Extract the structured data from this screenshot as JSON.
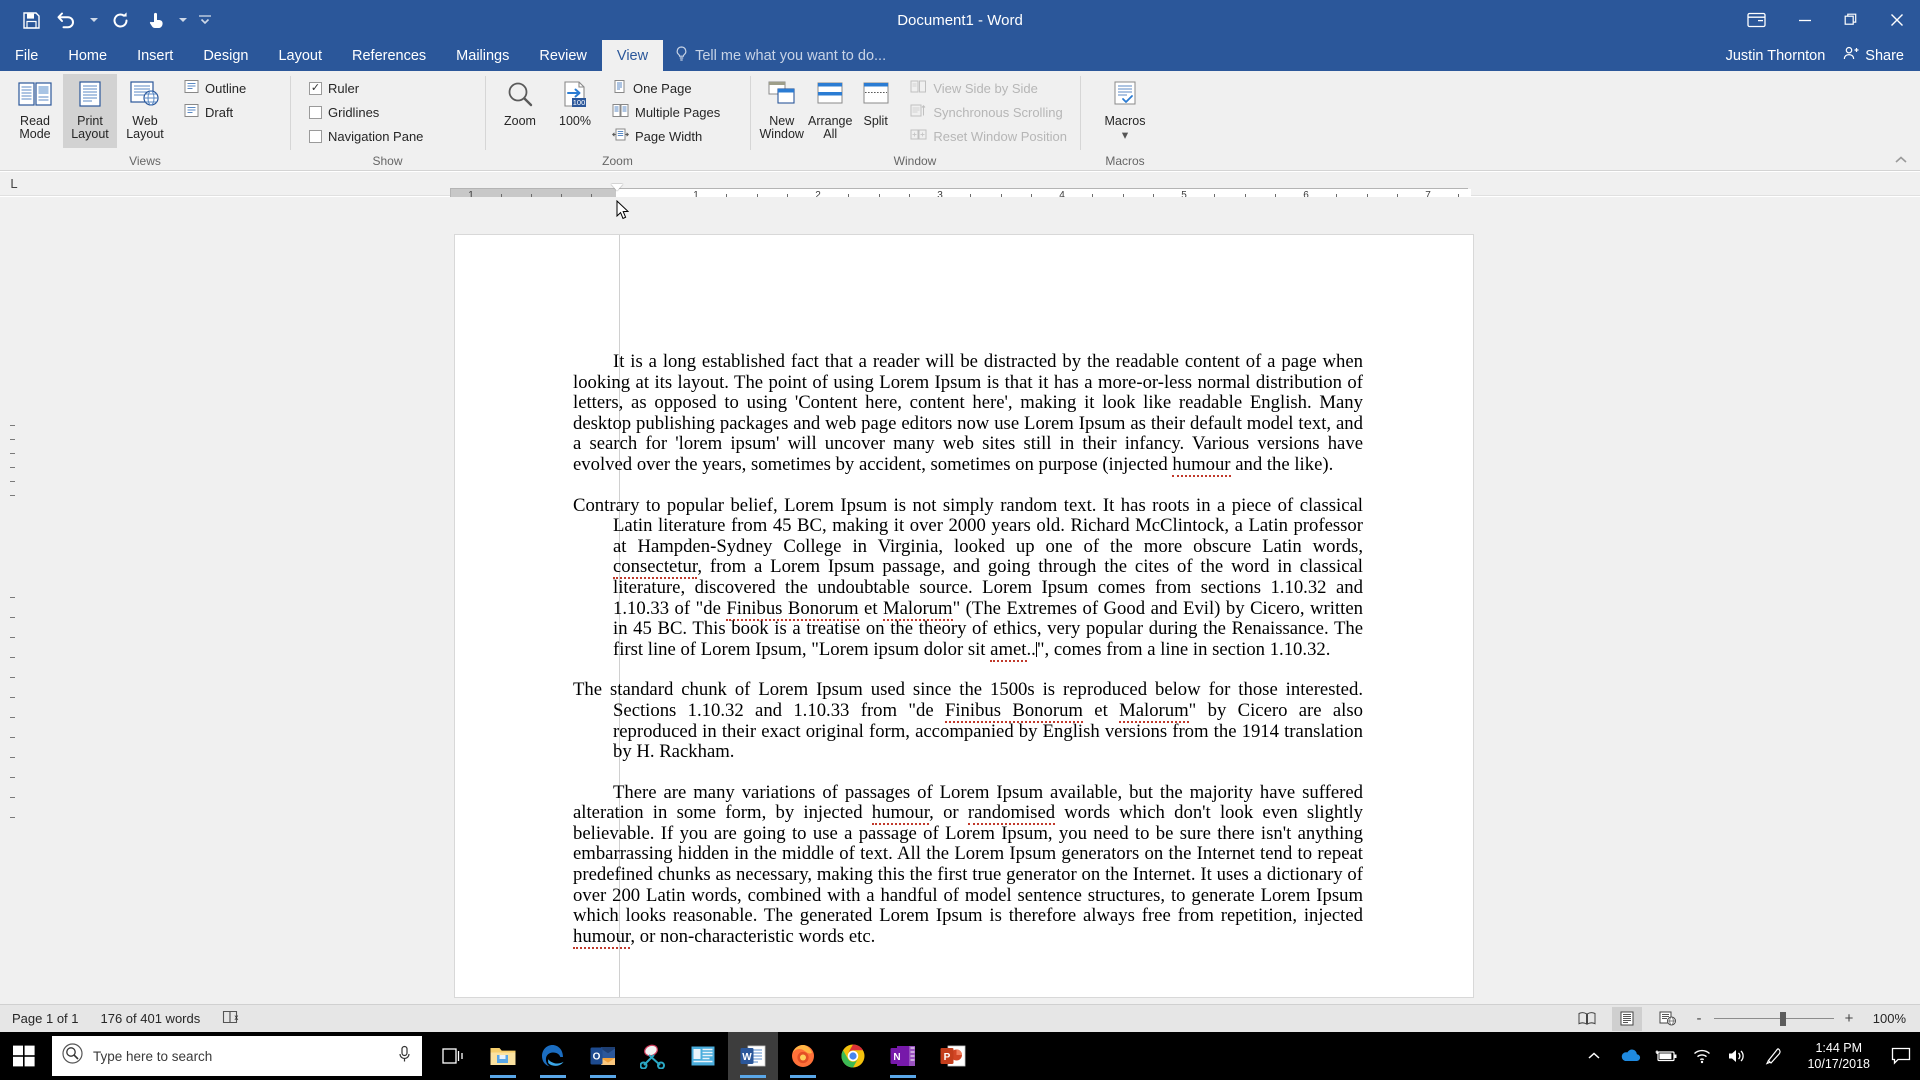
{
  "window": {
    "title": "Document1 - Word",
    "quick_access": [
      {
        "name": "save-icon",
        "label": "Save"
      },
      {
        "name": "undo-icon",
        "label": "Undo"
      },
      {
        "name": "redo-icon",
        "label": "Repeat Typing"
      },
      {
        "name": "touch-mode-icon",
        "label": "Touch/Mouse Mode"
      },
      {
        "name": "customize-qat-icon",
        "label": "Customize Quick Access Toolbar"
      }
    ],
    "controls": [
      {
        "name": "ribbon-display-options",
        "label": "Ribbon Display Options"
      },
      {
        "name": "minimize",
        "label": "Minimize"
      },
      {
        "name": "restore",
        "label": "Restore Down"
      },
      {
        "name": "close",
        "label": "Close"
      }
    ]
  },
  "tabs": [
    {
      "label": "File",
      "active": false
    },
    {
      "label": "Home",
      "active": false
    },
    {
      "label": "Insert",
      "active": false
    },
    {
      "label": "Design",
      "active": false
    },
    {
      "label": "Layout",
      "active": false
    },
    {
      "label": "References",
      "active": false
    },
    {
      "label": "Mailings",
      "active": false
    },
    {
      "label": "Review",
      "active": false
    },
    {
      "label": "View",
      "active": true
    }
  ],
  "tell_me": {
    "placeholder": "Tell me what you want to do...",
    "icon": "lightbulb-icon"
  },
  "account": {
    "user": "Justin Thornton",
    "share_label": "Share",
    "share_icon": "person-share-icon"
  },
  "ribbon": {
    "collapse_label": "⌃",
    "groups": [
      {
        "label": "Views",
        "big_buttons": [
          {
            "label": "Read\nMode",
            "line1": "Read",
            "line2": "Mode",
            "icon": "read-mode-icon",
            "active": false
          },
          {
            "label": "Print Layout",
            "line1": "Print",
            "line2": "Layout",
            "icon": "print-layout-icon",
            "active": true
          },
          {
            "label": "Web Layout",
            "line1": "Web",
            "line2": "Layout",
            "icon": "web-layout-icon",
            "active": false
          }
        ],
        "small_buttons": [
          {
            "label": "Outline",
            "icon": "outline-icon",
            "disabled": false
          },
          {
            "label": "Draft",
            "icon": "draft-icon",
            "disabled": false
          }
        ]
      },
      {
        "label": "Show",
        "checkboxes": [
          {
            "label": "Ruler",
            "checked": true
          },
          {
            "label": "Gridlines",
            "checked": false
          },
          {
            "label": "Navigation Pane",
            "checked": false
          }
        ]
      },
      {
        "label": "Zoom",
        "big_buttons": [
          {
            "label": "Zoom",
            "line1": "Zoom",
            "line2": "",
            "icon": "zoom-magnifier-icon",
            "active": false
          },
          {
            "label": "100%",
            "line1": "100%",
            "line2": "",
            "icon": "zoom-100-icon",
            "active": false
          }
        ],
        "small_buttons": [
          {
            "label": "One Page",
            "icon": "one-page-icon",
            "disabled": false
          },
          {
            "label": "Multiple Pages",
            "icon": "multiple-pages-icon",
            "disabled": false
          },
          {
            "label": "Page Width",
            "icon": "page-width-icon",
            "disabled": false
          }
        ]
      },
      {
        "label": "Window",
        "big_buttons": [
          {
            "label": "New Window",
            "line1": "New",
            "line2": "Window",
            "icon": "new-window-icon",
            "active": false
          },
          {
            "label": "Arrange All",
            "line1": "Arrange",
            "line2": "All",
            "icon": "arrange-all-icon",
            "active": false
          },
          {
            "label": "Split",
            "line1": "Split",
            "line2": "",
            "icon": "split-icon",
            "active": false
          }
        ],
        "small_buttons": [
          {
            "label": "View Side by Side",
            "icon": "view-side-by-side-icon",
            "disabled": true
          },
          {
            "label": "Synchronous Scrolling",
            "icon": "synchronous-scrolling-icon",
            "disabled": true
          },
          {
            "label": "Reset Window Position",
            "icon": "reset-window-position-icon",
            "disabled": true
          }
        ]
      },
      {
        "label": "Macros",
        "big_buttons": [
          {
            "label": "Macros",
            "line1": "Macros",
            "line2": "",
            "icon": "macros-icon",
            "active": false,
            "dropdown": true
          }
        ]
      }
    ]
  },
  "ruler": {
    "tab_selector": "L",
    "numbers": [
      "1",
      "1",
      "2",
      "3",
      "4",
      "5",
      "6",
      "7"
    ],
    "unit": "inches"
  },
  "document": {
    "paragraphs": [
      {
        "style": "first-line-indent",
        "text": "It is a long established fact that a reader will be distracted by the readable content of a page when looking at its layout. The point of using Lorem Ipsum is that it has a more-or-less normal distribution of letters, as opposed to using 'Content here, content here', making it look like readable English. Many desktop publishing packages and web page editors now use Lorem Ipsum as their default model text, and a search for 'lorem ipsum' will uncover many web sites still in their infancy. Various versions have evolved over the years, sometimes by accident, sometimes on purpose (injected humour and the like)."
      },
      {
        "style": "hanging-indent",
        "text": "Contrary to popular belief, Lorem Ipsum is not simply random text. It has roots in a piece of classical Latin literature from 45 BC, making it over 2000 years old. Richard McClintock, a Latin professor at Hampden-Sydney College in Virginia, looked up one of the more obscure Latin words, consectetur, from a Lorem Ipsum passage, and going through the cites of the word in classical literature, discovered the undoubtable source. Lorem Ipsum comes from sections 1.10.32 and 1.10.33 of \"de Finibus Bonorum et Malorum\" (The Extremes of Good and Evil) by Cicero, written in 45 BC. This book is a treatise on the theory of ethics, very popular during the Renaissance. The first line of Lorem Ipsum, \"Lorem ipsum dolor sit amet..\", comes from a line in section 1.10.32."
      },
      {
        "style": "hanging-indent",
        "text": "The standard chunk of Lorem Ipsum used since the 1500s is reproduced below for those interested. Sections 1.10.32 and 1.10.33 from \"de Finibus Bonorum et Malorum\" by Cicero are also reproduced in their exact original form, accompanied by English versions from the 1914 translation by H. Rackham."
      },
      {
        "style": "first-line-indent",
        "text": "There are many variations of passages of Lorem Ipsum available, but the majority have suffered alteration in some form, by injected humour, or randomised words which don't look even slightly believable. If you are going to use a passage of Lorem Ipsum, you need to be sure there isn't anything embarrassing hidden in the middle of text. All the Lorem Ipsum generators on the Internet tend to repeat predefined chunks as necessary, making this the first true generator on the Internet. It uses a dictionary of over 200 Latin words, combined with a handful of model sentence structures, to generate Lorem Ipsum which looks reasonable. The generated Lorem Ipsum is therefore always free from repetition, injected humour, or non-characteristic words etc."
      }
    ]
  },
  "status_bar": {
    "page_indicator": "Page 1 of 1",
    "word_count": "176 of 401 words",
    "proofing_icon": "proofing-errors-icon",
    "views": [
      {
        "name": "read-mode-view",
        "label": "Read Mode",
        "active": false
      },
      {
        "name": "print-layout-view",
        "label": "Print Layout",
        "active": true
      },
      {
        "name": "web-layout-view",
        "label": "Web Layout",
        "active": false
      }
    ],
    "zoom_out_label": "-",
    "zoom_in_label": "+",
    "zoom_value": "100%"
  },
  "taskbar": {
    "start_label": "Start",
    "search_placeholder": "Type here to search",
    "search_icon": "search-circle-icon",
    "mic_icon": "microphone-icon",
    "items": [
      {
        "name": "task-view-icon",
        "label": "Task View",
        "running": false,
        "focus": false
      },
      {
        "name": "file-explorer-icon",
        "label": "File Explorer",
        "running": true,
        "focus": false
      },
      {
        "name": "microsoft-edge-icon",
        "label": "Microsoft Edge",
        "running": true,
        "focus": false
      },
      {
        "name": "outlook-icon",
        "label": "Outlook",
        "running": true,
        "focus": false
      },
      {
        "name": "snip-sketch-icon",
        "label": "Snip & Sketch",
        "running": false,
        "focus": false
      },
      {
        "name": "sticky-notes-icon",
        "label": "Sticky Notes",
        "running": false,
        "focus": false
      },
      {
        "name": "word-icon",
        "label": "Word",
        "running": true,
        "focus": true
      },
      {
        "name": "firefox-icon",
        "label": "Firefox",
        "running": true,
        "focus": false
      },
      {
        "name": "chrome-icon",
        "label": "Google Chrome",
        "running": false,
        "focus": false
      },
      {
        "name": "onenote-icon",
        "label": "OneNote",
        "running": true,
        "focus": false
      },
      {
        "name": "powerpoint-icon",
        "label": "PowerPoint",
        "running": false,
        "focus": false
      }
    ],
    "tray": [
      {
        "name": "show-hidden-icons-icon",
        "label": "Show hidden icons"
      },
      {
        "name": "onedrive-icon",
        "label": "OneDrive"
      },
      {
        "name": "battery-icon",
        "label": "Battery"
      },
      {
        "name": "network-icon",
        "label": "Network"
      },
      {
        "name": "volume-icon",
        "label": "Volume"
      },
      {
        "name": "pen-icon",
        "label": "Windows Ink"
      }
    ],
    "clock": {
      "time": "1:44 PM",
      "date": "10/17/2018"
    },
    "notifications_icon": "action-center-icon"
  },
  "colors": {
    "word_blue": "#2b579a",
    "ribbon_bg": "#f0f0f0",
    "workspace_bg": "#f0f0f0",
    "taskbar_bg": "#000000",
    "accent_blue": "#5aa7e8"
  }
}
